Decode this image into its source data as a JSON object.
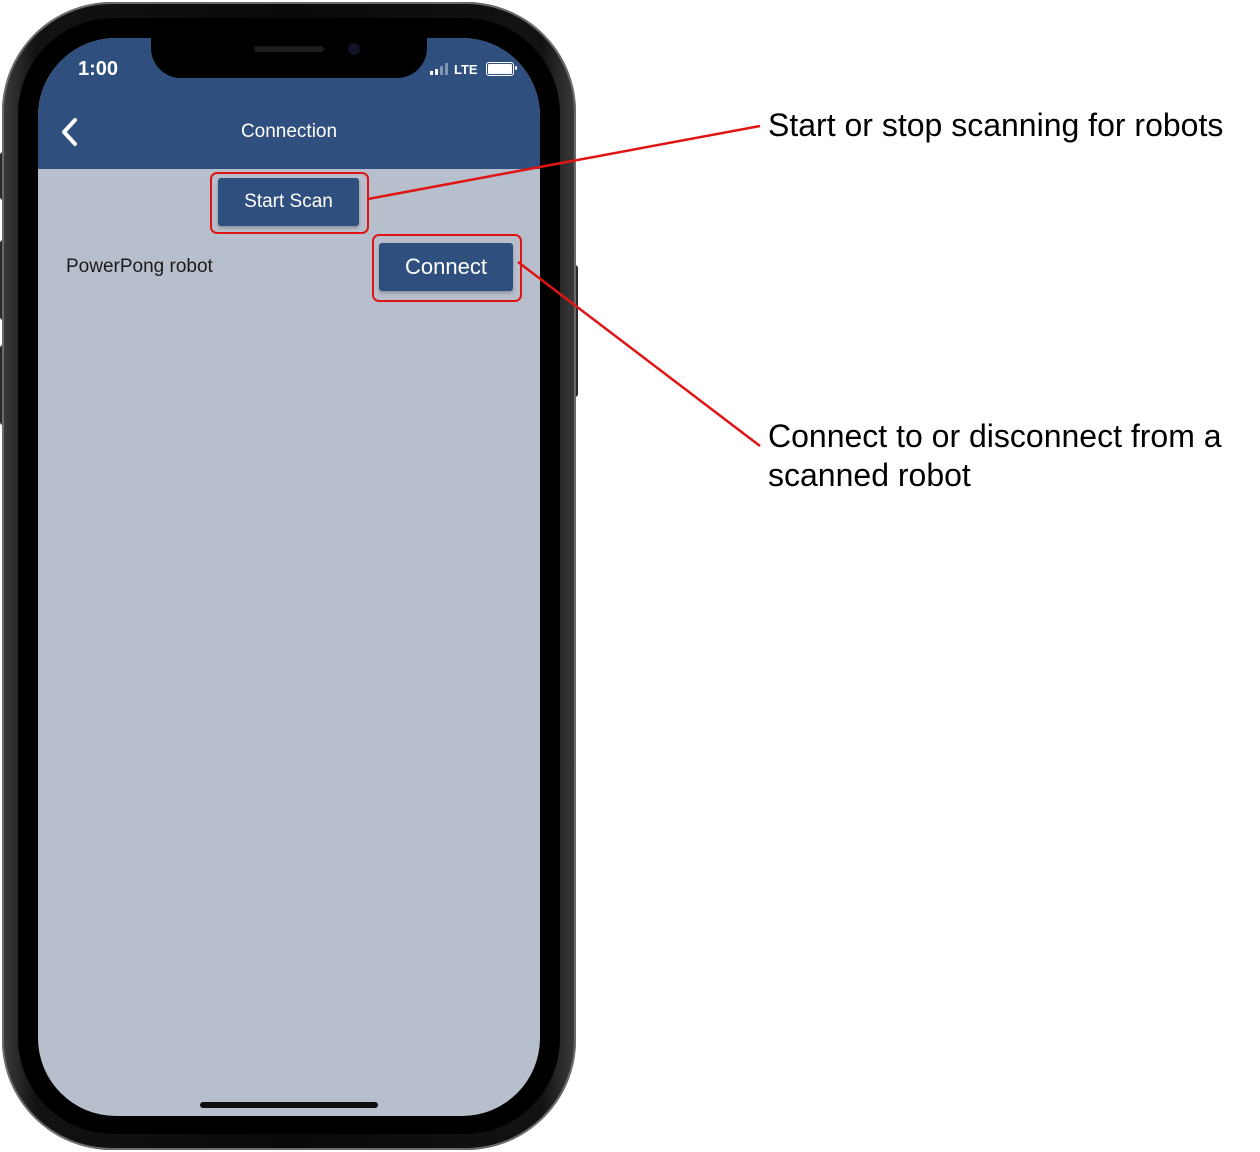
{
  "status_bar": {
    "time": "1:00",
    "network": "LTE"
  },
  "header": {
    "title": "Connection",
    "back_icon": "chevron-left-icon"
  },
  "scan_button": {
    "label": "Start Scan"
  },
  "device_list": [
    {
      "name": "PowerPong robot",
      "action_label": "Connect"
    }
  ],
  "annotations": [
    {
      "text": "Start or stop scanning for robots"
    },
    {
      "text": "Connect to or disconnect from a scanned robot"
    }
  ],
  "colors": {
    "header": "#2f4f7e",
    "screen_background": "#b8bfcc",
    "highlight": "#e01414",
    "button": "#2f4f7e"
  }
}
